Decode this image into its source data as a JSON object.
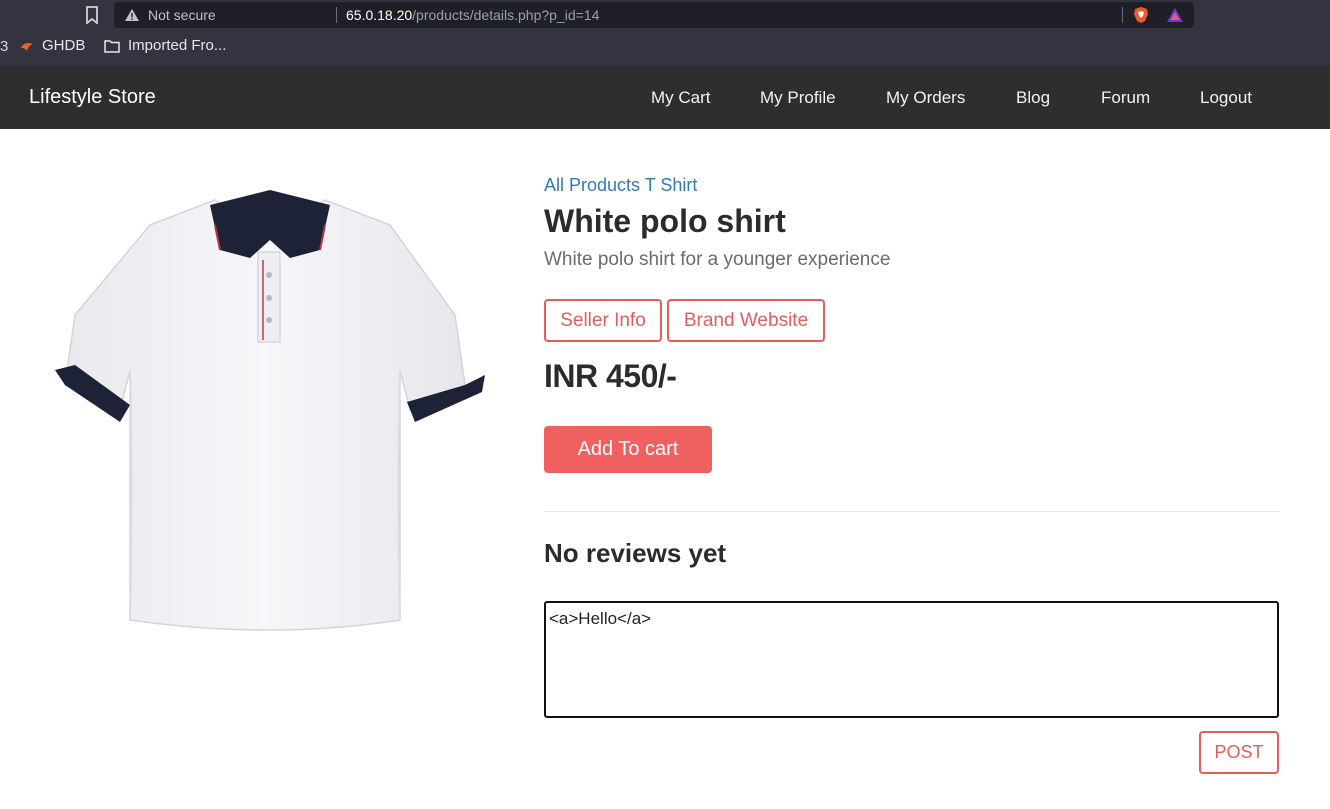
{
  "browser": {
    "security_label": "Not secure",
    "url_host": "65.0.18.20",
    "url_path": "/products/details.php?p_id=14",
    "bookmarks": [
      {
        "label": "GHDB"
      },
      {
        "label": "Imported Fro..."
      }
    ],
    "bookmark_edge": "3"
  },
  "navbar": {
    "brand": "Lifestyle Store",
    "links": [
      {
        "label": "My Cart"
      },
      {
        "label": "My Profile"
      },
      {
        "label": "My Orders"
      },
      {
        "label": "Blog"
      },
      {
        "label": "Forum"
      },
      {
        "label": "Logout"
      }
    ]
  },
  "product": {
    "breadcrumb": "All Products T Shirt",
    "name": "White polo shirt",
    "description": "White polo shirt for a younger experience",
    "seller_button": "Seller Info",
    "brand_button": "Brand Website",
    "price": "INR 450/-",
    "add_to_cart": "Add To cart"
  },
  "reviews": {
    "heading": "No reviews yet",
    "textarea_value": "<a>Hello</a>",
    "post_button": "POST"
  },
  "colors": {
    "accent": "#f06060",
    "link": "#337ab7",
    "navbar_bg": "#2e2e2e"
  }
}
